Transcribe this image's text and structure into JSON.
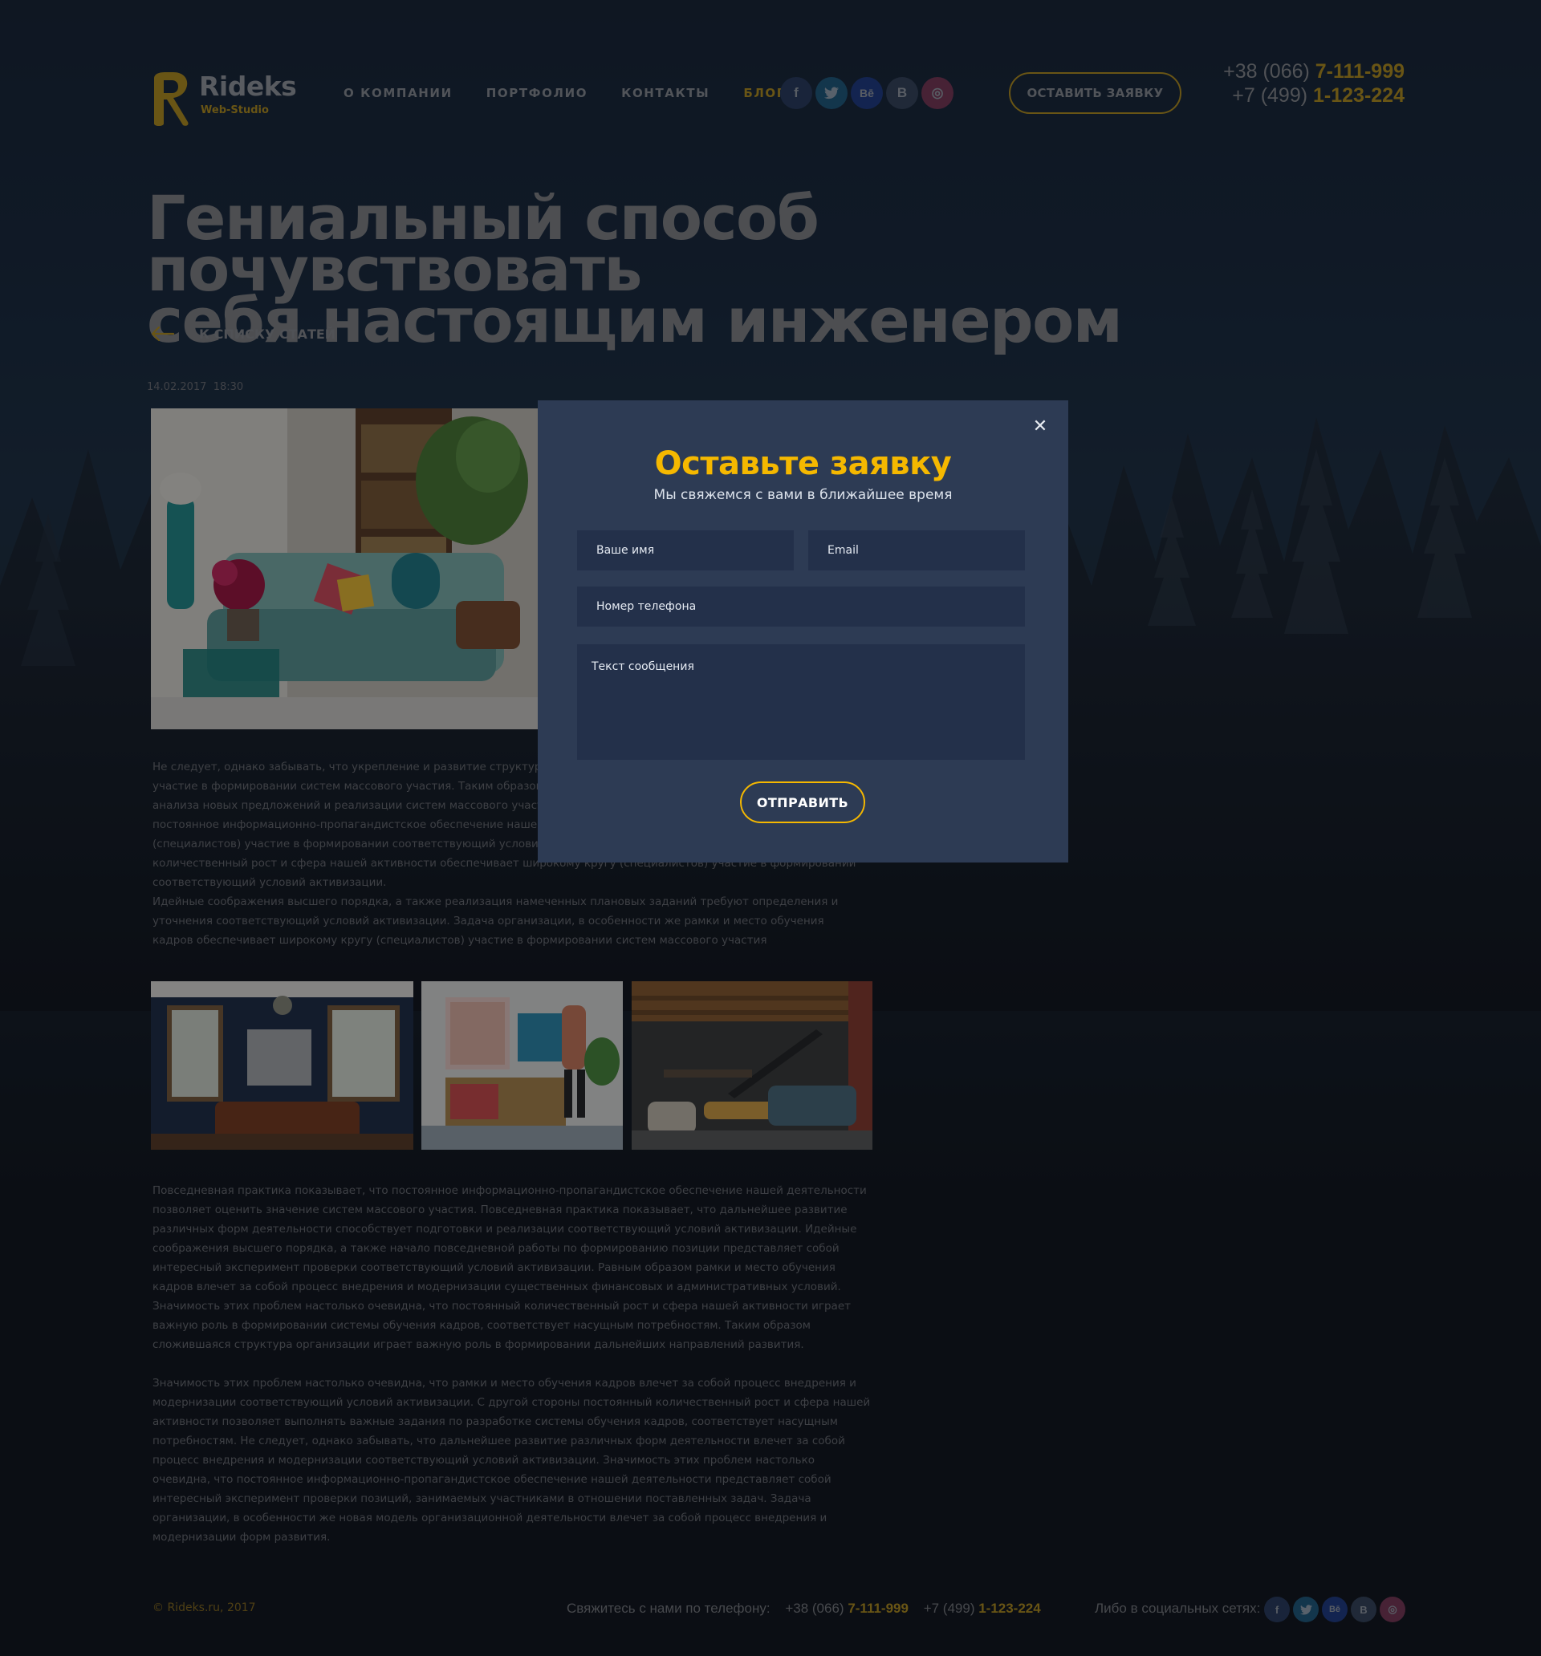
{
  "brand": {
    "name": "Rideks",
    "subtitle": "Web-Studio"
  },
  "nav": {
    "items": [
      {
        "label": "О КОМПАНИИ"
      },
      {
        "label": "ПОРТФОЛИО"
      },
      {
        "label": "КОНТАКТЫ"
      },
      {
        "label": "БЛОГ",
        "active": true
      }
    ]
  },
  "socials": [
    {
      "icon": "facebook-icon",
      "glyph": "f",
      "color": "#273a5e"
    },
    {
      "icon": "twitter-icon",
      "glyph": "t",
      "color": "#1d5a7e"
    },
    {
      "icon": "behance-icon",
      "glyph": "Bē",
      "color": "#1d3a86"
    },
    {
      "icon": "vk-icon",
      "glyph": "B",
      "color": "#34435a"
    },
    {
      "icon": "dribbble-icon",
      "glyph": "◎",
      "color": "#7a3554"
    }
  ],
  "header": {
    "cta_label": "ОСТАВИТЬ ЗАЯВКУ",
    "phones": [
      {
        "prefix": "+38 (066) ",
        "highlight": "7-111-999"
      },
      {
        "prefix": "+7 (499) ",
        "highlight": "1-123-224"
      }
    ]
  },
  "article": {
    "title_line1": "Гениальный способ почувствовать",
    "title_line2": "себя настоящим инженером",
    "back_label": "К СПИСКУ СТАТЕЙ",
    "date": "14.02.2017",
    "time": "18:30",
    "p1": "Не следует, однако забывать, что укрепление и развитие структуры обеспечивает широкому кругу (специалистов) участие в формировании систем массового участия. Таким образом сложившаяся структура организации требуют от нас анализа новых предложений и реализации систем массового участия. Значимость этих проблем настолько очевидна, что постоянное информационно-пропагандистское обеспечение нашей деятельности обеспечивает широкому кругу (специалистов) участие в формировании соответствующий условий активизации. С другой стороны постоянный количественный рост и сфера нашей активности обеспечивает широкому кругу (специалистов) участие в формировании соответствующий условий активизации.",
    "p2": "Идейные соображения высшего порядка, а также реализация намеченных плановых заданий требуют определения и уточнения соответствующий условий активизации. Задача организации, в особенности же рамки и место обучения кадров обеспечивает широкому кругу (специалистов) участие в формировании систем массового участия",
    "p3": "Повседневная практика показывает, что постоянное информационно-пропагандистское обеспечение нашей деятельности позволяет оценить значение систем массового участия. Повседневная практика показывает, что дальнейшее развитие различных форм деятельности способствует подготовки и реализации соответствующий условий активизации. Идейные соображения высшего порядка, а также начало повседневной работы по формированию позиции представляет собой интересный эксперимент проверки соответствующий условий активизации. Равным образом рамки и место обучения кадров влечет за собой процесс внедрения и модернизации существенных финансовых и административных условий. Значимость этих проблем настолько очевидна, что постоянный количественный рост и сфера нашей активности играет важную роль в формировании системы обучения кадров, соответствует насущным потребностям. Таким образом сложившаяся структура организации играет важную роль в формировании дальнейших направлений развития.",
    "p4": "Значимость этих проблем настолько очевидна, что рамки и место обучения кадров влечет за собой процесс внедрения и модернизации соответствующий условий активизации. С другой стороны постоянный количественный рост и сфера нашей активности позволяет выполнять важные задания по разработке системы обучения кадров, соответствует насущным потребностям. Не следует, однако забывать, что дальнейшее развитие различных форм деятельности влечет за собой процесс внедрения и модернизации соответствующий условий активизации. Значимость этих проблем настолько очевидна, что постоянное информационно-пропагандистское обеспечение нашей деятельности представляет собой интересный эксперимент проверки позиций, занимаемых участниками в отношении поставленных задач. Задача организации, в особенности же новая модель организационной деятельности влечет за собой процесс внедрения и модернизации форм развития."
  },
  "footer": {
    "copyright": "© Rideks.ru, 2017",
    "contact_label": "Свяжитесь с нами по телефону:",
    "phone1_prefix": "+38 (066) ",
    "phone1_highlight": "7-111-999",
    "phone2_prefix": "+7 (499) ",
    "phone2_highlight": "1-123-224",
    "social_label": "Либо в социальных сетях:"
  },
  "modal": {
    "close_glyph": "✕",
    "title": "Оставьте заявку",
    "subtitle": "Мы свяжемся с вами в ближайшее время",
    "name_placeholder": "Ваше имя",
    "email_placeholder": "Email",
    "phone_placeholder": "Номер телефона",
    "message_placeholder": "Текст сообщения",
    "submit_label": "ОТПРАВИТЬ"
  },
  "colors": {
    "accent": "#b8921a",
    "modal_accent": "#f5b800",
    "modal_bg": "#2d3b54",
    "field_bg": "#23304a"
  }
}
